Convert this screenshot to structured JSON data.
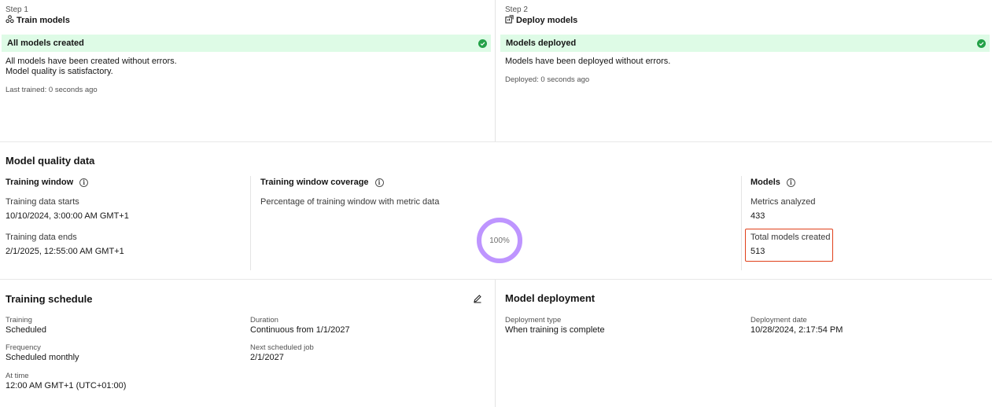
{
  "step1": {
    "step_label": "Step 1",
    "title": "Train models",
    "icon": "train-models-icon",
    "banner": "All models created",
    "message_line1": "All models have been created without errors.",
    "message_line2": "Model quality is satisfactory.",
    "meta": "Last trained: 0 seconds ago"
  },
  "step2": {
    "step_label": "Step 2",
    "title": "Deploy models",
    "icon": "deploy-models-icon",
    "banner": "Models deployed",
    "message_line1": "Models have been deployed without errors.",
    "meta": "Deployed: 0 seconds ago"
  },
  "quality": {
    "title": "Model quality data",
    "training_window": {
      "title": "Training window",
      "starts_label": "Training data starts",
      "starts_value": "10/10/2024, 3:00:00 AM GMT+1",
      "ends_label": "Training data ends",
      "ends_value": "2/1/2025, 12:55:00 AM GMT+1"
    },
    "coverage": {
      "title": "Training window coverage",
      "description": "Percentage of training window with metric data",
      "percent_label": "100%",
      "percent_value": 100
    },
    "models": {
      "title": "Models",
      "metrics_label": "Metrics analyzed",
      "metrics_value": "433",
      "total_label": "Total models created",
      "total_value": "513"
    }
  },
  "schedule": {
    "title": "Training schedule",
    "training_label": "Training",
    "training_value": "Scheduled",
    "frequency_label": "Frequency",
    "frequency_value": "Scheduled monthly",
    "at_time_label": "At time",
    "at_time_value": "12:00 AM GMT+1 (UTC+01:00)",
    "duration_label": "Duration",
    "duration_value": "Continuous from 1/1/2027",
    "next_job_label": "Next scheduled job",
    "next_job_value": "2/1/2027"
  },
  "deployment": {
    "title": "Model deployment",
    "type_label": "Deployment type",
    "type_value": "When training is complete",
    "date_label": "Deployment date",
    "date_value": "10/28/2024, 2:17:54 PM"
  },
  "colors": {
    "success_bg": "#defbe6",
    "success_check": "#24a148",
    "donut": "#be95ff",
    "highlight": "#e0401a"
  }
}
